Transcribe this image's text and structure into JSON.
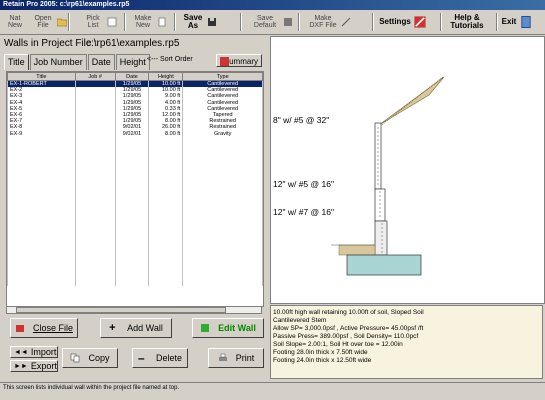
{
  "window": {
    "title": "Retain Pro 2005: c:\\rp61\\examples.rp5"
  },
  "toolbar": {
    "new_file": "Nat\nNew",
    "open_file": "Open\nFile",
    "pick_list": "Pick\nList",
    "make_new": "Make\nNew",
    "save": "Save\nAs",
    "save_default": "Save\nDefault",
    "make_dxf": "Make\nDXF File",
    "settings": "Settings",
    "help": "Help &\nTutorials",
    "exit": "Exit"
  },
  "path": {
    "label": "Walls in Project File :",
    "value": "c:\\rp61\\examples.rp5"
  },
  "tabs": [
    "Title",
    "Job Number",
    "Date",
    "Height",
    "Type"
  ],
  "sort_only": "<--- Sort Order",
  "summary_button": "Summary",
  "table": {
    "headers": [
      "Title",
      "Job #",
      "Date",
      "Height",
      "Type"
    ],
    "rows": [
      [
        "EX-1-ROBERT",
        "",
        "1/29/05",
        "10.00 ft",
        "Cantilevered"
      ],
      [
        "EX-2",
        "",
        "1/29/05",
        "10.00 ft",
        "Cantilevered"
      ],
      [
        "EX-3",
        "",
        "1/29/05",
        "9.00 ft",
        "Cantilevered"
      ],
      [
        "EX-4",
        "",
        "1/29/05",
        "4.00 ft",
        "Cantilevered"
      ],
      [
        "EX-5",
        "",
        "1/29/05",
        "0.33 ft",
        "Cantilevered"
      ],
      [
        "EX-6",
        "",
        "1/29/05",
        "12.00 ft",
        "Tapered"
      ],
      [
        "EX-7",
        "",
        "1/29/05",
        "8.00 ft",
        "Restrained"
      ],
      [
        "EX-8",
        "",
        "9/02/01",
        "26.00 ft",
        "Restrained"
      ],
      [
        "EX-9",
        "",
        "9/02/01",
        "8.00 ft",
        "Gravity"
      ]
    ]
  },
  "drawing": {
    "labels": [
      "8\" w/ #5 @ 32\"",
      "12\" w/ #5 @ 16\"",
      "12\" w/ #7 @ 16\""
    ]
  },
  "description": [
    "10.00ft high wall retaining 10.00ft of soil, Sloped Soil",
    "Cantilevered Stem",
    "Allow SP= 3,000.0psf , Active Pressure= 45.00psf /ft",
    "Passive Press= 389.00psf , Soil Density= 110.0pcf",
    "Soil Slope= 2.00:1, Soil Ht over toe = 12.00in",
    "Footing 28.0in thick x 7.50ft wide",
    "Footing 24.0in thick x 12.50ft wide"
  ],
  "buttons": {
    "close_file": "Close File",
    "add_wall": "Add Wall",
    "edit_wall": "Edit Wall",
    "import": "Import",
    "export": "Export",
    "copy": "Copy",
    "delete": "Delete",
    "print": "Print"
  },
  "status": "This screen lists individual wall within the project file named at top.",
  "colors": {
    "selection": "#0a246a",
    "description_bg": "#f7f3de",
    "soil": "#d8c79a",
    "footing": "#a8d4d4"
  }
}
